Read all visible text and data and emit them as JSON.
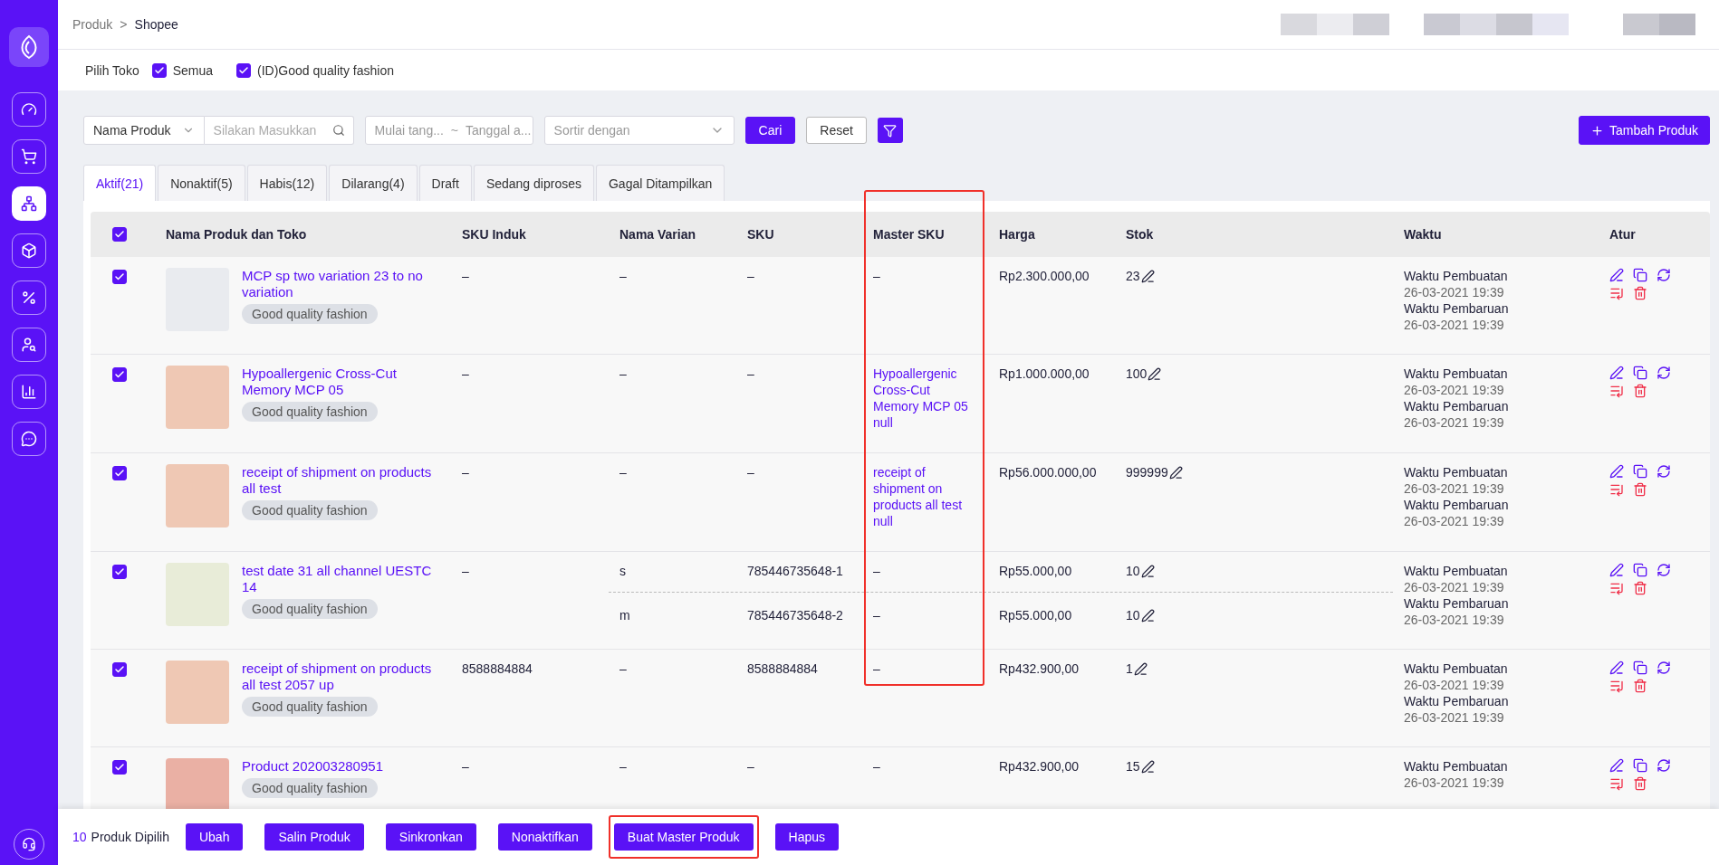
{
  "sidebar": {
    "nav": [
      {
        "selected": false
      },
      {
        "selected": false
      },
      {
        "selected": true
      },
      {
        "selected": false
      },
      {
        "selected": false
      },
      {
        "selected": false
      },
      {
        "selected": false
      },
      {
        "selected": false
      }
    ]
  },
  "breadcrumb": {
    "items": [
      "Produk",
      "Shopee"
    ],
    "separator": ">"
  },
  "shop_filter": {
    "label": "Pilih Toko",
    "options": [
      {
        "label": "Semua",
        "checked": true
      },
      {
        "label": "(ID)Good quality fashion",
        "checked": true
      }
    ]
  },
  "toolbar": {
    "field_select": "Nama Produk",
    "search": {
      "placeholder": "Silakan Masukkan"
    },
    "date_range": {
      "start": "Mulai tang...",
      "separator": "~",
      "end": "Tanggal a..."
    },
    "sort": {
      "placeholder": "Sortir dengan"
    },
    "buttons": [
      {
        "label": "Cari",
        "kind": "primary"
      },
      {
        "label": "Reset",
        "kind": "default"
      }
    ],
    "add_button": "Tambah Produk"
  },
  "tabs": [
    {
      "label": "Aktif(21)",
      "selected": true
    },
    {
      "label": "Nonaktif(5)",
      "selected": false
    },
    {
      "label": "Habis(12)",
      "selected": false
    },
    {
      "label": "Dilarang(4)",
      "selected": false
    },
    {
      "label": "Draft",
      "selected": false
    },
    {
      "label": "Sedang diproses",
      "selected": false
    },
    {
      "label": "Gagal Ditampilkan",
      "selected": false
    }
  ],
  "table": {
    "all_checked": true,
    "columns": [
      {
        "label": "Nama Produk dan Toko",
        "highlighted": false
      },
      {
        "label": "SKU Induk",
        "highlighted": false
      },
      {
        "label": "Nama Varian",
        "highlighted": false
      },
      {
        "label": "SKU",
        "highlighted": false
      },
      {
        "label": "Master SKU",
        "highlighted": true
      },
      {
        "label": "Harga",
        "highlighted": false
      },
      {
        "label": "Stok",
        "highlighted": false
      },
      {
        "label": "Waktu",
        "highlighted": false
      },
      {
        "label": "Atur",
        "highlighted": false
      }
    ],
    "rows": [
      {
        "checked": true,
        "name": "MCP sp two variation 23 to no variation",
        "shop": "Good quality fashion",
        "sku_induk": "–",
        "variants": [
          {
            "name": "–",
            "sku": "–",
            "master_sku": "–",
            "master_linked": false,
            "price": "Rp2.300.000,00",
            "stock": "23"
          }
        ],
        "times": [
          {
            "label": "Waktu Pembuatan",
            "value": "26-03-2021 19:39"
          },
          {
            "label": "Waktu Pembaruan",
            "value": "26-03-2021 19:39"
          }
        ]
      },
      {
        "checked": true,
        "name": "Hypoallergenic Cross-Cut Memory MCP 05",
        "shop": "Good quality fashion",
        "sku_induk": "–",
        "variants": [
          {
            "name": "–",
            "sku": "–",
            "master_sku": "Hypoallergenic Cross-Cut Memory MCP 05 null",
            "master_linked": true,
            "price": "Rp1.000.000,00",
            "stock": "100"
          }
        ],
        "times": [
          {
            "label": "Waktu Pembuatan",
            "value": "26-03-2021 19:39"
          },
          {
            "label": "Waktu Pembaruan",
            "value": "26-03-2021 19:39"
          }
        ]
      },
      {
        "checked": true,
        "name": "receipt of shipment on products all test",
        "shop": "Good quality fashion",
        "sku_induk": "–",
        "variants": [
          {
            "name": "–",
            "sku": "–",
            "master_sku": "receipt of shipment on products all test null",
            "master_linked": true,
            "price": "Rp56.000.000,00",
            "stock": "999999"
          }
        ],
        "times": [
          {
            "label": "Waktu Pembuatan",
            "value": "26-03-2021 19:39"
          },
          {
            "label": "Waktu Pembaruan",
            "value": "26-03-2021 19:39"
          }
        ]
      },
      {
        "checked": true,
        "name": "test date 31 all channel UESTC 14",
        "shop": "Good quality fashion",
        "sku_induk": "–",
        "variants": [
          {
            "name": "s",
            "sku": "785446735648-1",
            "master_sku": "–",
            "master_linked": false,
            "price": "Rp55.000,00",
            "stock": "10"
          },
          {
            "name": "m",
            "sku": "785446735648-2",
            "master_sku": "–",
            "master_linked": false,
            "price": "Rp55.000,00",
            "stock": "10"
          }
        ],
        "times": [
          {
            "label": "Waktu Pembuatan",
            "value": "26-03-2021 19:39"
          },
          {
            "label": "Waktu Pembaruan",
            "value": "26-03-2021 19:39"
          }
        ]
      },
      {
        "checked": true,
        "name": "receipt of shipment on products all test 2057 up",
        "shop": "Good quality fashion",
        "sku_induk": "8588884884",
        "variants": [
          {
            "name": "–",
            "sku": "8588884884",
            "master_sku": "–",
            "master_linked": false,
            "price": "Rp432.900,00",
            "stock": "1"
          }
        ],
        "times": [
          {
            "label": "Waktu Pembuatan",
            "value": "26-03-2021 19:39"
          },
          {
            "label": "Waktu Pembaruan",
            "value": "26-03-2021 19:39"
          }
        ]
      },
      {
        "checked": true,
        "name": "Product 202003280951",
        "shop": "Good quality fashion",
        "sku_induk": "–",
        "variants": [
          {
            "name": "–",
            "sku": "–",
            "master_sku": "–",
            "master_linked": false,
            "price": "Rp432.900,00",
            "stock": "15"
          }
        ],
        "times": [
          {
            "label": "Waktu Pembuatan",
            "value": "26-03-2021 19:39"
          }
        ]
      }
    ]
  },
  "bulk_bar": {
    "count": "10",
    "label": "Produk Dipilih",
    "buttons": [
      {
        "label": "Ubah",
        "highlighted": false
      },
      {
        "label": "Salin Produk",
        "highlighted": false
      },
      {
        "label": "Sinkronkan",
        "highlighted": false
      },
      {
        "label": "Nonaktifkan",
        "highlighted": false
      },
      {
        "label": "Buat Master Produk",
        "highlighted": true
      },
      {
        "label": "Hapus",
        "highlighted": false
      }
    ]
  }
}
